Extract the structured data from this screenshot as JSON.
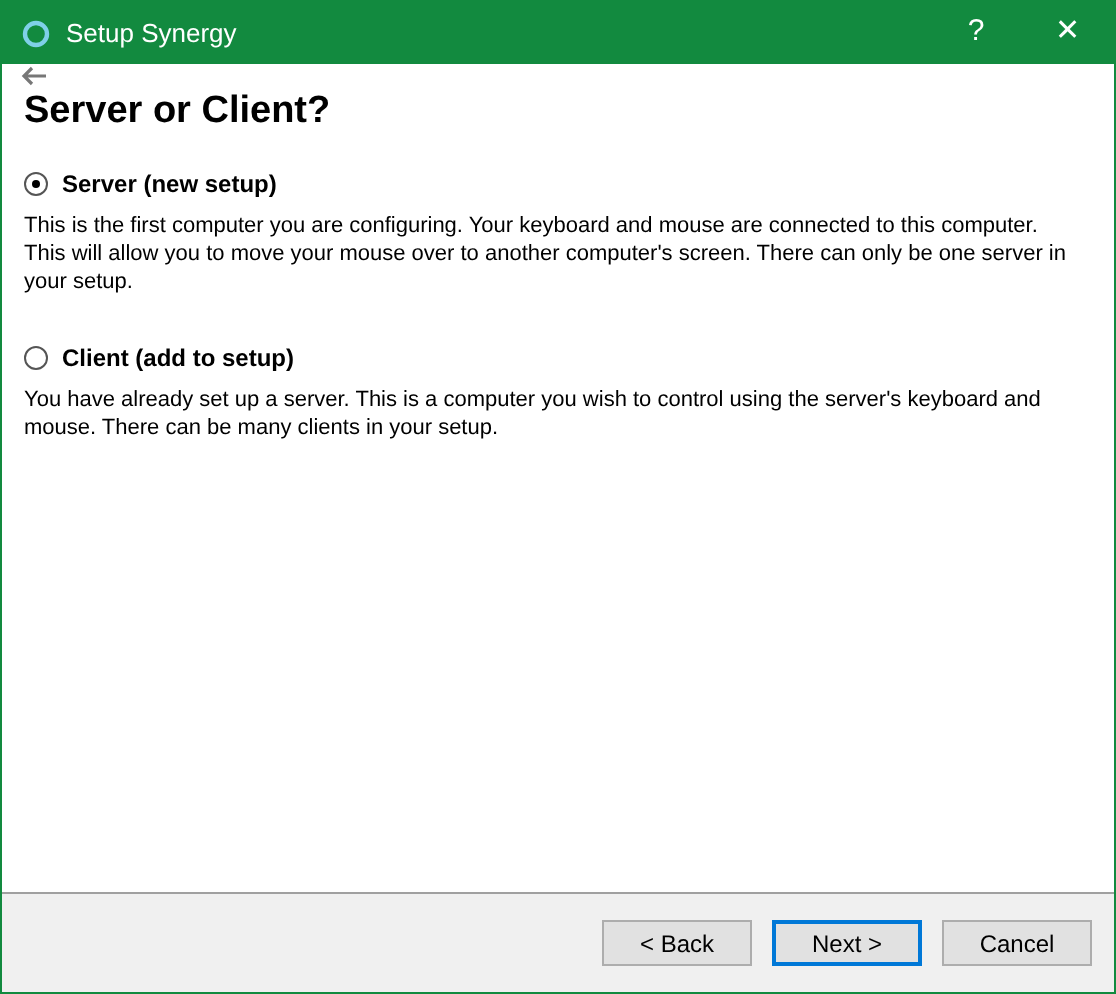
{
  "window": {
    "title": "Setup Synergy",
    "buttons": [
      "?",
      "✕"
    ]
  },
  "heading": "Server or Client?",
  "options": [
    {
      "label": "Server (new setup)",
      "selected": true,
      "description": "This is the first computer you are configuring. Your keyboard and mouse are connected to this computer. This will allow you to move your mouse over to another computer's screen. There can only be one server in your setup."
    },
    {
      "label": "Client (add to setup)",
      "selected": false,
      "description": "You have already set up a server. This is a computer you wish to control using the server's keyboard and mouse. There can be many clients in your setup."
    }
  ],
  "footer_buttons": [
    {
      "label": "< Back",
      "default": false
    },
    {
      "label": "Next >",
      "default": true
    },
    {
      "label": "Cancel",
      "default": false
    }
  ]
}
